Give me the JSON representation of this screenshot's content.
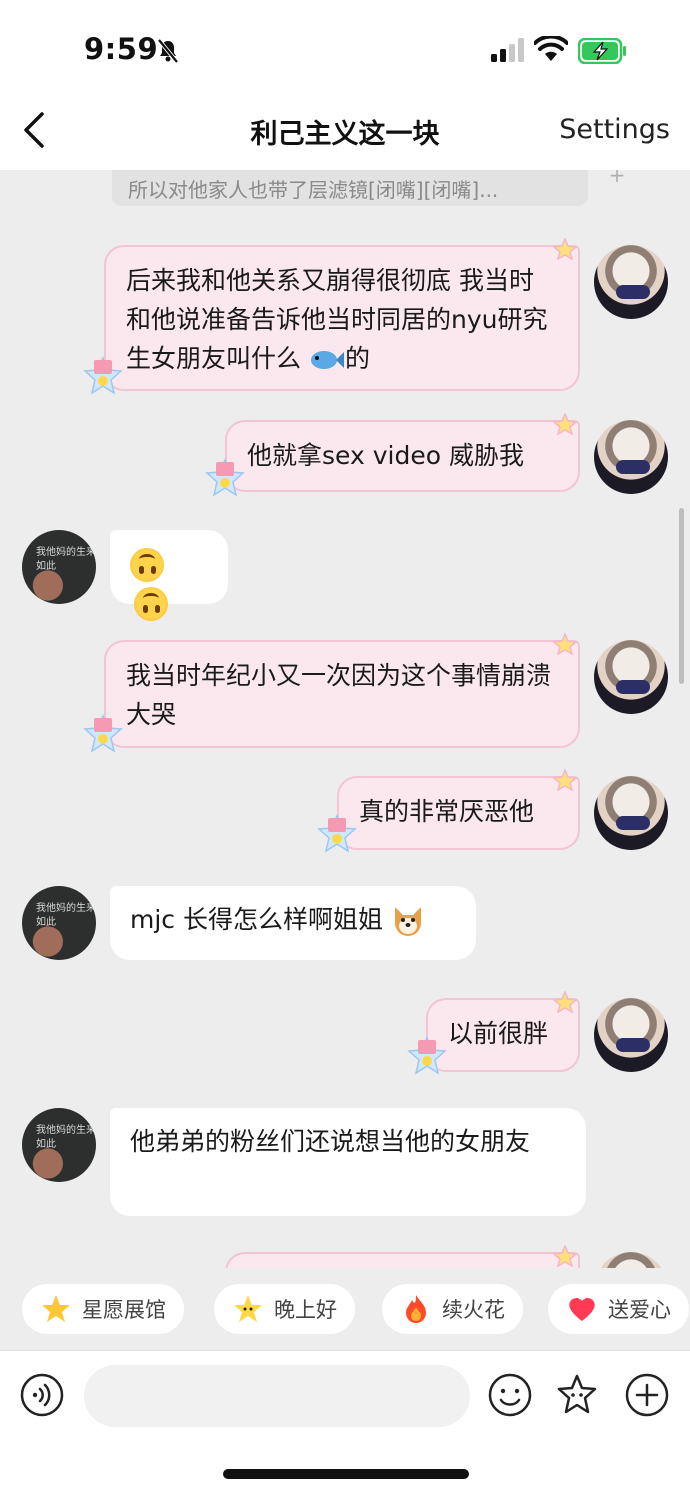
{
  "status_bar": {
    "time": "9:59"
  },
  "header": {
    "title": "利己主义这一块",
    "settings_label": "Settings"
  },
  "quoted_message": {
    "text": "所以对他家人也带了层滤镜[闭嘴][闭嘴]..."
  },
  "messages": [
    {
      "side": "right",
      "text": "后来我和他关系又崩得很彻底 我当时和他说准备告诉他当时同居的nyu研究生女朋友叫什么",
      "suffix": "的",
      "emoji": "fish"
    },
    {
      "side": "right",
      "text": "他就拿sex video 威胁我"
    },
    {
      "side": "left",
      "emoji": "upside-down-face x2"
    },
    {
      "side": "right",
      "text": "我当时年纪小又一次因为这个事情崩溃大哭"
    },
    {
      "side": "right",
      "text": "真的非常厌恶他"
    },
    {
      "side": "left",
      "text": "mjc 长得怎么样啊姐姐",
      "emoji": "dog-face"
    },
    {
      "side": "right",
      "text": "以前很胖"
    },
    {
      "side": "left",
      "text": "他弟弟的粉丝们还说想当他的女朋友"
    }
  ],
  "quick_replies": [
    {
      "label": "星愿展馆",
      "icon": "star-icon"
    },
    {
      "label": "晚上好",
      "icon": "star-face-icon"
    },
    {
      "label": "续火花",
      "icon": "fire-icon"
    },
    {
      "label": "送爱心",
      "icon": "heart-icon"
    }
  ],
  "input": {
    "placeholder": ""
  },
  "colors": {
    "right_bubble_bg": "#fbe8ee",
    "right_bubble_border": "#f3c4d2",
    "chat_bg": "#ededed",
    "battery_green": "#34c759"
  }
}
